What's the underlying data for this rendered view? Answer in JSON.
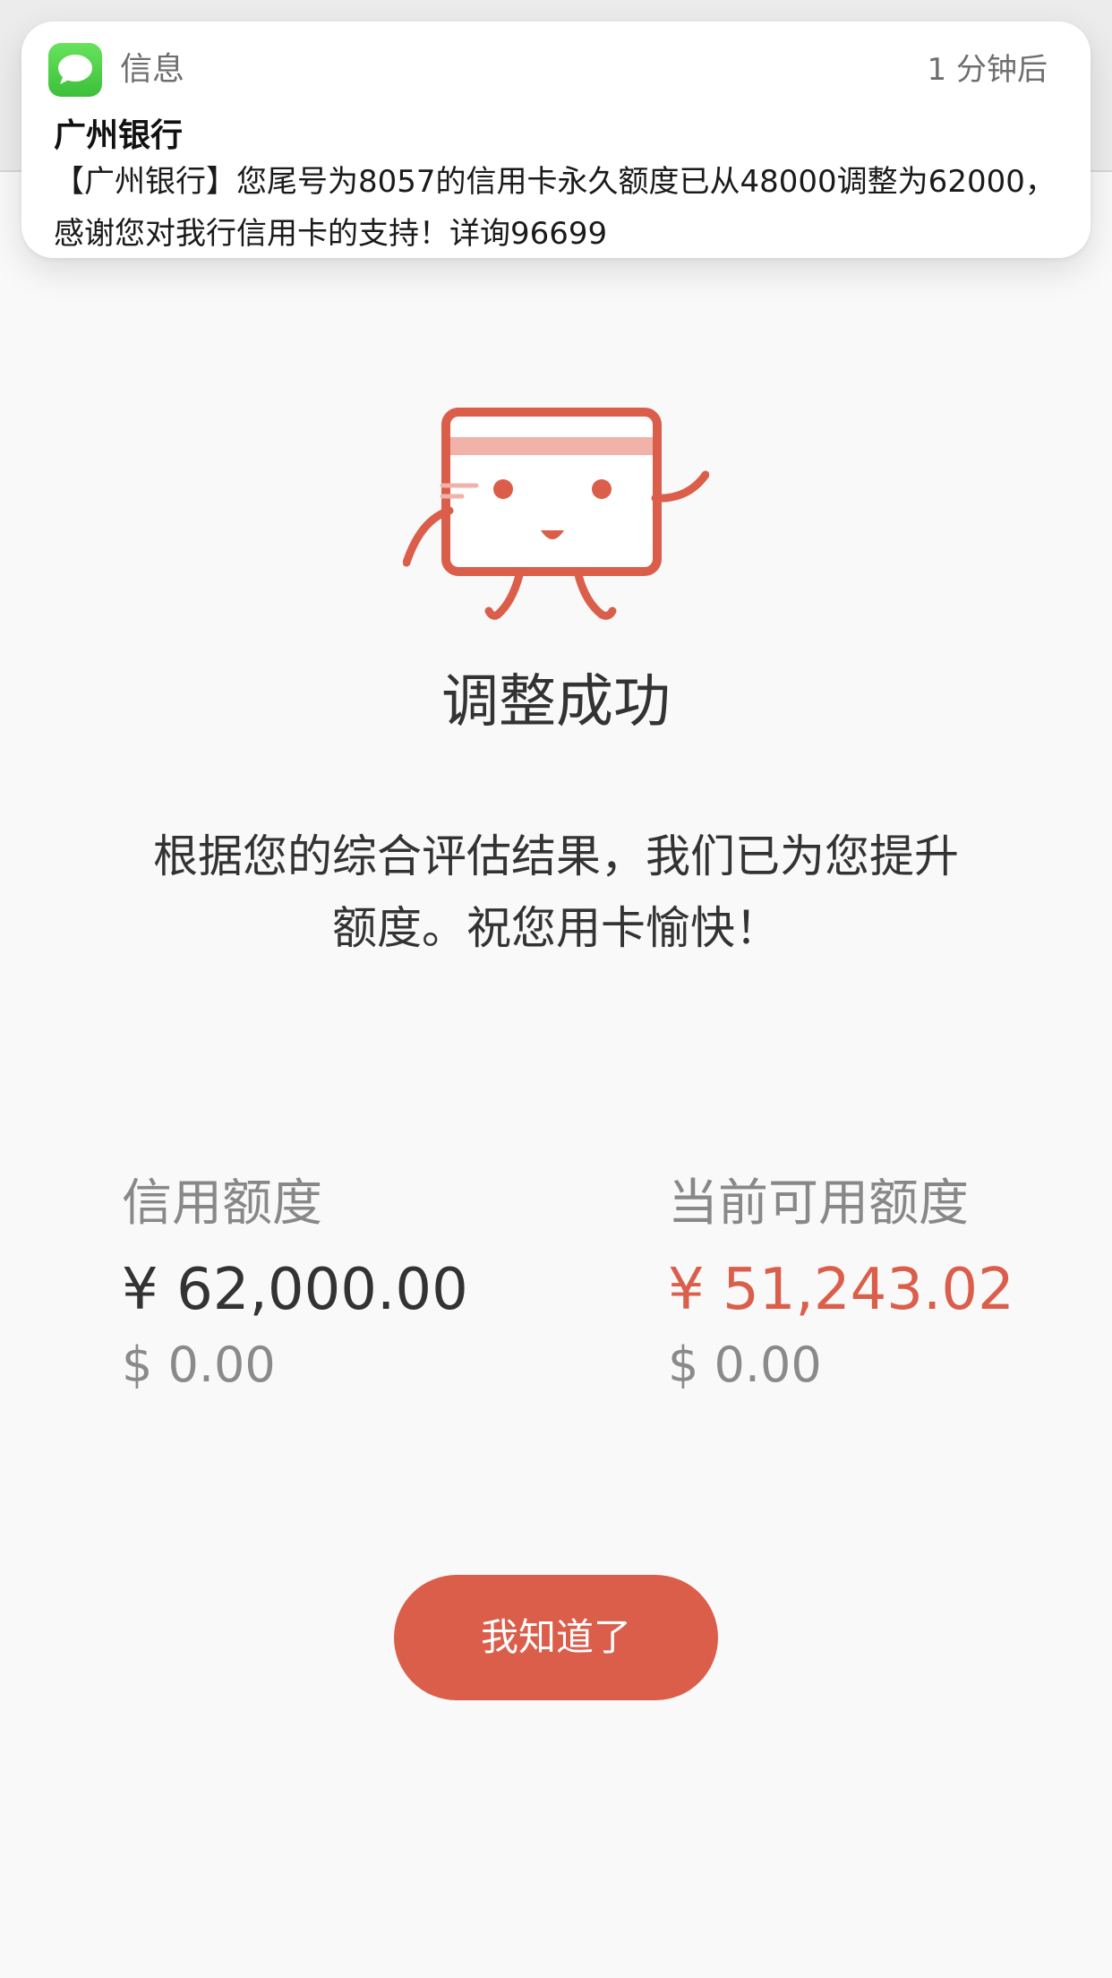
{
  "notification": {
    "app_name": "信息",
    "time": "1 分钟后",
    "title": "广州银行",
    "body": "【广州银行】您尾号为8057的信用卡永久额度已从48000调整为62000，感谢您对我行信用卡的支持！详询96699",
    "icon": "messages-icon"
  },
  "illustration": {
    "icon": "credit-card-mascot-icon",
    "color": "#db5e4b",
    "stripe_color": "#f0b2a9"
  },
  "result": {
    "title": "调整成功",
    "description": "根据您的综合评估结果，我们已为您提升额度。祝您用卡愉快！"
  },
  "credit": {
    "limit_label": "信用额度",
    "limit_cny": "¥ 62,000.00",
    "limit_usd": "$ 0.00",
    "available_label": "当前可用额度",
    "available_cny": "¥ 51,243.02",
    "available_usd": "$ 0.00"
  },
  "actions": {
    "confirm_label": "我知道了"
  },
  "colors": {
    "accent": "#db5e4b",
    "background": "#f9f9f9",
    "text_primary": "#333333",
    "text_secondary": "#888888"
  }
}
